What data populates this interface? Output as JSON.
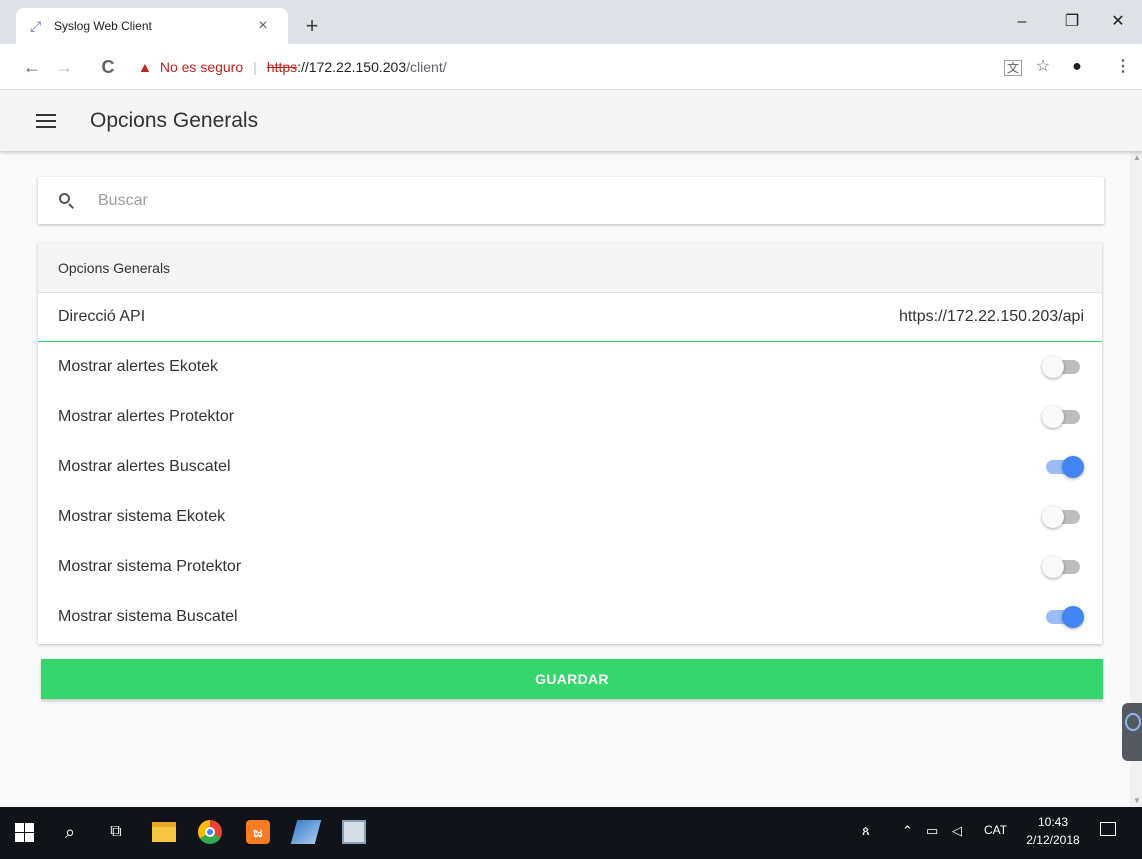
{
  "browser": {
    "tab_title": "Syslog Web Client",
    "tab_icon": "syslog-tab-icon",
    "tab_close": "×",
    "new_tab": "+",
    "window_controls": {
      "minimize": "–",
      "maximize": "❐",
      "close": "✕"
    },
    "nav": {
      "back": "←",
      "forward": "→",
      "reload": "C"
    },
    "security_warning": "No es seguro",
    "url_scheme": "https",
    "url_host": "://172.22.150.203",
    "url_path": "/client/"
  },
  "app": {
    "title": "Opcions Generals",
    "search_placeholder": "Buscar",
    "section_header": "Opcions Generals",
    "api_label": "Direcció API",
    "api_value": "https://172.22.150.203/api",
    "settings": [
      {
        "label": "Mostrar alertes Ekotek",
        "enabled": false
      },
      {
        "label": "Mostrar alertes Protektor",
        "enabled": false
      },
      {
        "label": "Mostrar alertes Buscatel",
        "enabled": true
      },
      {
        "label": "Mostrar sistema Ekotek",
        "enabled": false
      },
      {
        "label": "Mostrar sistema Protektor",
        "enabled": false
      },
      {
        "label": "Mostrar sistema Buscatel",
        "enabled": true
      }
    ],
    "save_label": "GUARDAR",
    "colors": {
      "accent_green": "#35d66b",
      "toggle_on": "#4285f4"
    }
  },
  "taskbar": {
    "tray_language": "CAT",
    "time": "10:43",
    "date": "2/12/2018"
  }
}
